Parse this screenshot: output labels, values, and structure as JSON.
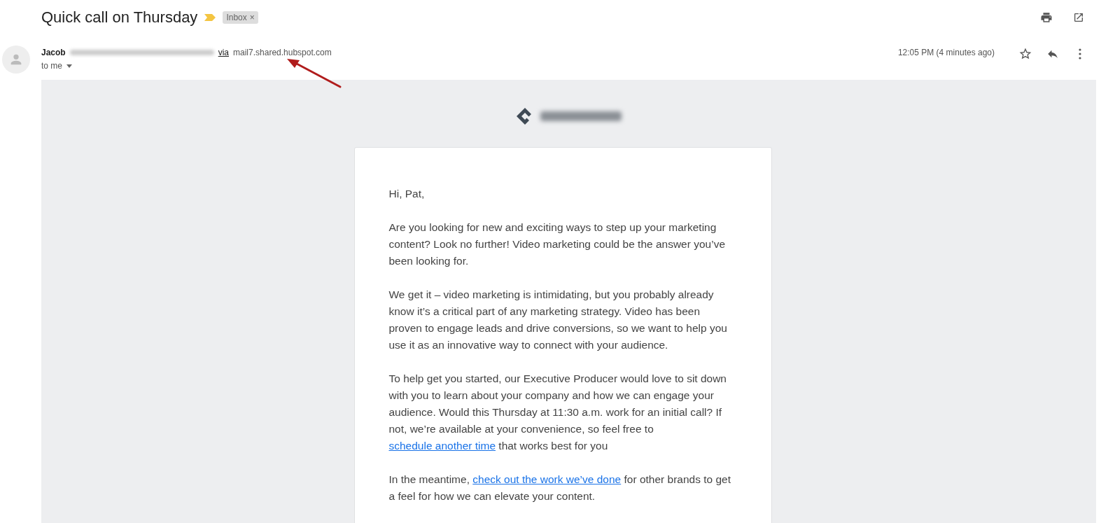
{
  "subject": {
    "title": "Quick call on Thursday",
    "important": true,
    "labels": [
      {
        "text": "Inbox",
        "remove": "×"
      }
    ]
  },
  "message": {
    "sender_name": "Jacob",
    "via_label": "via",
    "via_domain": "mail7.shared.hubspot.com",
    "recipient": "to me",
    "time": "12:05 PM (4 minutes ago)",
    "starred": false
  },
  "body": {
    "paragraphs": [
      [
        {
          "text": "Hi, Pat,"
        }
      ],
      [
        {
          "text": "Are you looking for new and exciting ways to step up your marketing content? Look no further! Video marketing could be the answer you’ve been looking for."
        }
      ],
      [
        {
          "text": "We get it – video marketing is intimidating, but you probably already know it’s a critical part of any marketing strategy. Video has been proven to engage leads and drive conversions, so we want to help you use it as an innovative way to connect with your audience."
        }
      ],
      [
        {
          "text": "To help get you started, our Executive Producer would love to sit down with you to learn about your company and how we can engage your audience. Would this Thursday at 11:30 a.m. work for an initial call? If not, we’re available at your convenience, so feel free to "
        },
        {
          "text": "schedule another time",
          "link": true
        },
        {
          "text": " that works best for you"
        }
      ],
      [
        {
          "text": "In the meantime, "
        },
        {
          "text": "check out the work we’ve done",
          "link": true
        },
        {
          "text": " for other brands to get a feel for how we can elevate your content."
        }
      ]
    ]
  }
}
